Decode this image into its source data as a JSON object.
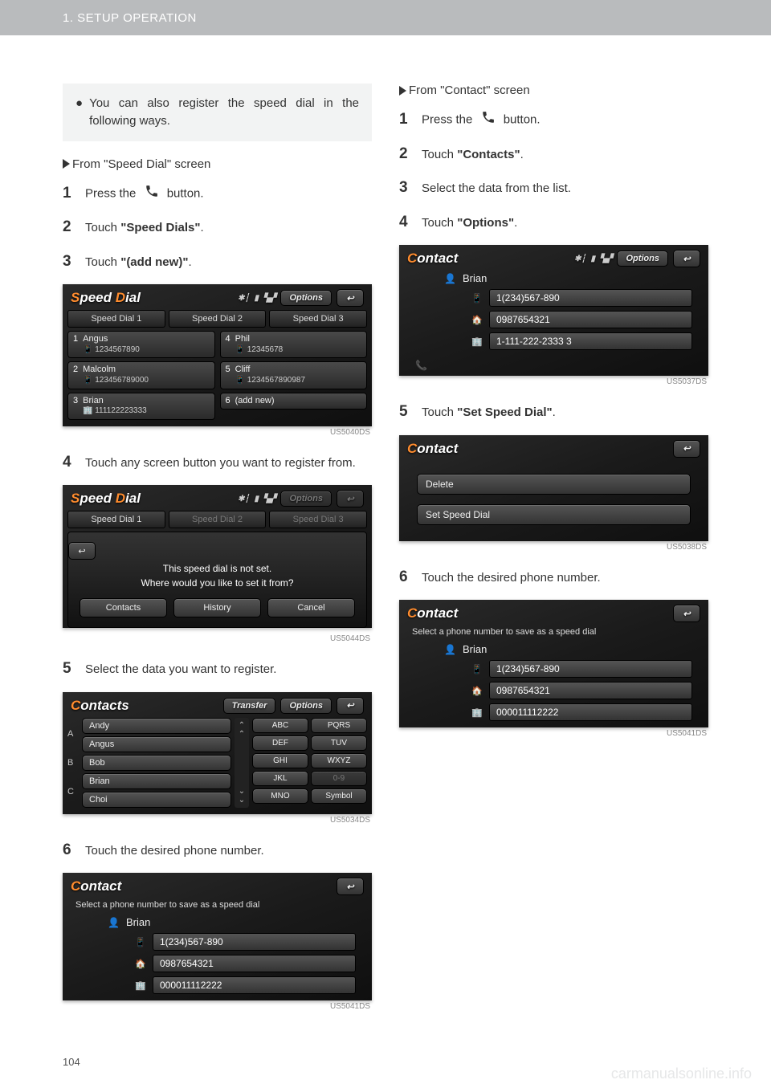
{
  "header": {
    "title": "1. SETUP OPERATION"
  },
  "page_number": "104",
  "watermark": "carmanualsonline.info",
  "left": {
    "note": "You can also register the speed dial in the following ways.",
    "from_speed_dial": "From \"Speed Dial\" screen",
    "step1_a": "Press the ",
    "step1_b": " button.",
    "step2_a": "Touch ",
    "step2_b": "\"Speed Dials\"",
    "step2_c": ".",
    "step3_a": "Touch ",
    "step3_b": "\"(add new)\"",
    "step3_c": ".",
    "step4": "Touch any screen button you want to register from.",
    "step5": "Select the data you want to register.",
    "step6": "Touch the desired phone number.",
    "shot1": {
      "title": "Speed Dial",
      "options": "Options",
      "tabs": [
        "Speed Dial 1",
        "Speed Dial 2",
        "Speed Dial 3"
      ],
      "cells": [
        {
          "n": "1",
          "name": "Angus",
          "num": "1234567890"
        },
        {
          "n": "2",
          "name": "Malcolm",
          "num": "123456789000"
        },
        {
          "n": "3",
          "name": "Brian",
          "num": "111122223333"
        },
        {
          "n": "4",
          "name": "Phil",
          "num": "12345678"
        },
        {
          "n": "5",
          "name": "Cliff",
          "num": "1234567890987"
        },
        {
          "n": "6",
          "name": "(add new)",
          "num": ""
        }
      ],
      "id": "US5040DS"
    },
    "shot2": {
      "title": "Speed Dial",
      "options": "Options",
      "tab1": "Speed Dial 1",
      "tab2": "Speed Dial 2",
      "tab3": "Speed Dial 3",
      "msg1": "This speed dial is not set.",
      "msg2": "Where would you like to set it from?",
      "b1": "Contacts",
      "b2": "History",
      "b3": "Cancel",
      "id": "US5044DS"
    },
    "shot3": {
      "title": "Contacts",
      "transfer": "Transfer",
      "options": "Options",
      "idx": [
        "A",
        "B",
        "C"
      ],
      "names": [
        "Andy",
        "Angus",
        "Bob",
        "Brian",
        "Choi"
      ],
      "keysL": [
        "ABC",
        "DEF",
        "GHI",
        "JKL",
        "MNO"
      ],
      "keysR": [
        "PQRS",
        "TUV",
        "WXYZ",
        "0-9",
        "Symbol"
      ],
      "id": "US5034DS"
    },
    "shot4": {
      "title": "Contact",
      "sub": "Select a phone number to save as a speed dial",
      "name": "Brian",
      "nums": [
        "1(234)567-890",
        "0987654321",
        "000011112222"
      ],
      "id": "US5041DS"
    }
  },
  "right": {
    "from_contact": "From \"Contact\" screen",
    "step1_a": "Press the ",
    "step1_b": " button.",
    "step2_a": "Touch ",
    "step2_b": "\"Contacts\"",
    "step2_c": ".",
    "step3": "Select the data from the list.",
    "step4_a": "Touch ",
    "step4_b": "\"Options\"",
    "step4_c": ".",
    "step5_a": "Touch ",
    "step5_b": "\"Set Speed Dial\"",
    "step5_c": ".",
    "step6": "Touch the desired phone number.",
    "shot1": {
      "title": "Contact",
      "options": "Options",
      "name": "Brian",
      "nums": [
        "1(234)567-890",
        "0987654321",
        "1-111-222-2333 3"
      ],
      "id": "US5037DS"
    },
    "shot2": {
      "title": "Contact",
      "opts": [
        "Delete",
        "Set Speed Dial"
      ],
      "id": "US5038DS"
    },
    "shot3": {
      "title": "Contact",
      "sub": "Select a phone number to save as a speed dial",
      "name": "Brian",
      "nums": [
        "1(234)567-890",
        "0987654321",
        "000011112222"
      ],
      "id": "US5041DS"
    }
  }
}
